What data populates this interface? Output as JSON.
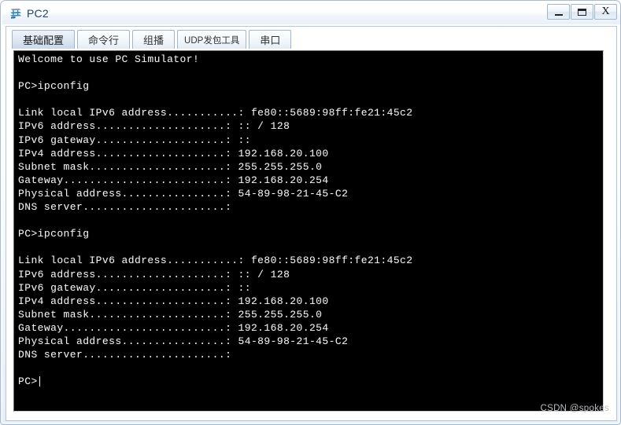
{
  "window": {
    "title": "PC2",
    "icon": "switch-device-icon",
    "controls": {
      "minimize_label": "—",
      "maximize_label": "❐",
      "close_label": "X"
    }
  },
  "tabs": [
    {
      "label": "基础配置",
      "name": "tab-basic-config",
      "active": true,
      "small": false
    },
    {
      "label": "命令行",
      "name": "tab-command-line",
      "active": false,
      "small": false
    },
    {
      "label": "组播",
      "name": "tab-multicast",
      "active": false,
      "small": false
    },
    {
      "label": "UDP发包工具",
      "name": "tab-udp-sender",
      "active": false,
      "small": true
    },
    {
      "label": "串口",
      "name": "tab-serial-port",
      "active": false,
      "small": false
    }
  ],
  "terminal": {
    "background": "#000000",
    "foreground": "#f2f2f2",
    "prompt": "PC>",
    "content": "Welcome to use PC Simulator!\n\nPC>ipconfig\n\nLink local IPv6 address...........: fe80::5689:98ff:fe21:45c2\nIPv6 address....................: :: / 128\nIPv6 gateway....................: ::\nIPv4 address....................: 192.168.20.100\nSubnet mask.....................: 255.255.255.0\nGateway.........................: 192.168.20.254\nPhysical address................: 54-89-98-21-45-C2\nDNS server......................: \n\nPC>ipconfig\n\nLink local IPv6 address...........: fe80::5689:98ff:fe21:45c2\nIPv6 address....................: :: / 128\nIPv6 gateway....................: ::\nIPv4 address....................: 192.168.20.100\nSubnet mask.....................: 255.255.255.0\nGateway.........................: 192.168.20.254\nPhysical address................: 54-89-98-21-45-C2\nDNS server......................: \n\nPC>",
    "ipconfig": {
      "link_local_ipv6_address": "fe80::5689:98ff:fe21:45c2",
      "ipv6_address": ":: / 128",
      "ipv6_gateway": "::",
      "ipv4_address": "192.168.20.100",
      "subnet_mask": "255.255.255.0",
      "gateway": "192.168.20.254",
      "physical_address": "54-89-98-21-45-C2",
      "dns_server": ""
    }
  },
  "watermark": {
    "text": "CSDN @spokes"
  }
}
